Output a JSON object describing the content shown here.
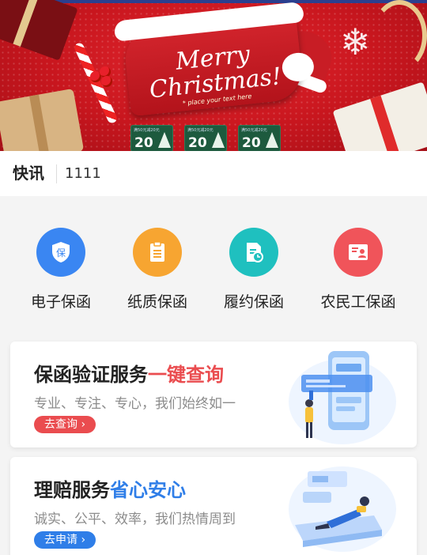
{
  "banner": {
    "title_line1": "Merry",
    "title_line2": "Christmas!",
    "subtitle": "* place your text here",
    "tickets": [
      {
        "label": "满50元减20元",
        "value": "20"
      },
      {
        "label": "满50元减20元",
        "value": "20"
      },
      {
        "label": "满50元减20元",
        "value": "20"
      }
    ],
    "colors": {
      "red": "#c8161e",
      "ticket_green": "#1d5a3e"
    }
  },
  "news": {
    "label": "快讯",
    "text": "1111"
  },
  "services": [
    {
      "label": "电子保函",
      "icon": "shield-bao-icon",
      "color": "#3a86f2"
    },
    {
      "label": "纸质保函",
      "icon": "clipboard-icon",
      "color": "#f7a531"
    },
    {
      "label": "履约保函",
      "icon": "document-clock-icon",
      "color": "#1fc0bf"
    },
    {
      "label": "农民工保函",
      "icon": "id-card-person-icon",
      "color": "#f0545a"
    }
  ],
  "cards": [
    {
      "title_main": "保函验证服务",
      "title_highlight": "一键查询",
      "highlight_color": "#ea4c4f",
      "description": "专业、专注、专心，我们始终如一",
      "button_label": "去查询",
      "button_icon": "chevron-right-icon",
      "button_color": "#ea4c4f",
      "art": "phone-verification-illustration"
    },
    {
      "title_main": "理赔服务",
      "title_highlight": "省心安心",
      "highlight_color": "#2f7ee8",
      "description": "诚实、公平、效率，我们热情周到",
      "button_label": "去申请",
      "button_icon": "chevron-right-icon",
      "button_color": "#2f7ee8",
      "art": "relaxing-person-illustration"
    }
  ]
}
